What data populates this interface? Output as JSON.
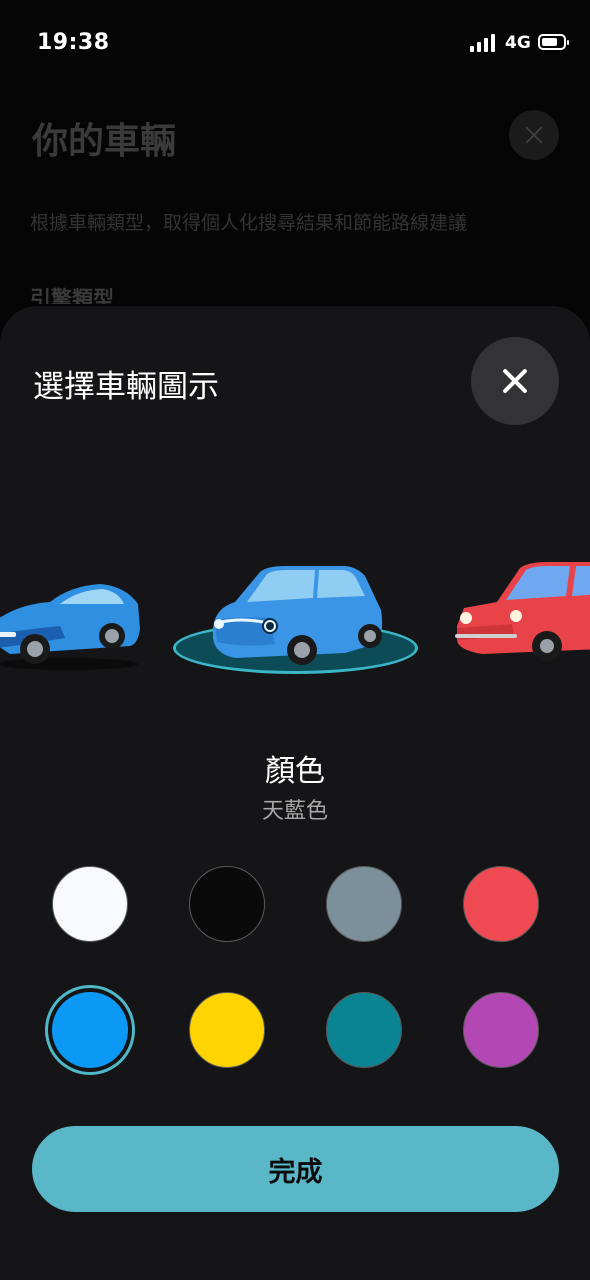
{
  "status_bar": {
    "time": "19:38",
    "network": "4G"
  },
  "background_page": {
    "title": "你的車輛",
    "description": "根據車輛類型，取得個人化搜尋結果和節能路線建議",
    "section_label": "引擎類型"
  },
  "sheet": {
    "title": "選擇車輛圖示",
    "color_heading": "顏色",
    "selected_color_name": "天藍色",
    "done_label": "完成"
  },
  "vehicles": [
    {
      "icon": "sports-car-icon",
      "color": "#2f8fe0"
    },
    {
      "icon": "hatchback-car-icon",
      "color": "#3a95e6",
      "selected": true
    },
    {
      "icon": "classic-car-icon",
      "color": "#e9434a"
    }
  ],
  "swatches": [
    {
      "name": "white",
      "color": "#f7f9ff"
    },
    {
      "name": "black",
      "color": "#0a0a0a"
    },
    {
      "name": "gray",
      "color": "#7c909c"
    },
    {
      "name": "red",
      "color": "#f04a55"
    },
    {
      "name": "sky-blue",
      "color": "#0c98f5",
      "selected": true
    },
    {
      "name": "yellow",
      "color": "#ffd400"
    },
    {
      "name": "teal",
      "color": "#0a8392"
    },
    {
      "name": "purple",
      "color": "#b347b3"
    }
  ]
}
